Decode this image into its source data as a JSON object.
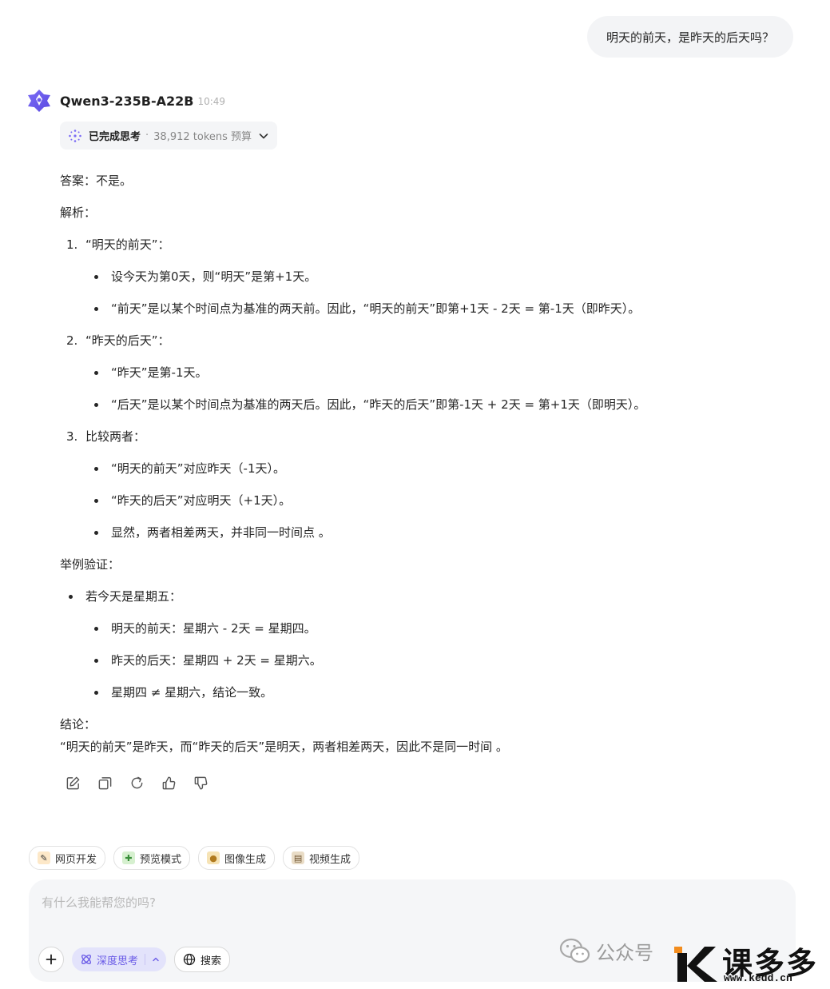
{
  "user_message": "明天的前天，是昨天的后天吗？",
  "assistant": {
    "model_name": "Qwen3-235B-A22B",
    "time": "10:49",
    "think_status": "已完成思考",
    "think_separator": "·",
    "think_budget": "38,912 tokens 预算"
  },
  "answer": {
    "answer_line": "答案：不是。",
    "analysis_label": "解析：",
    "item1_num": "1.",
    "item1_title": "“明天的前天”：",
    "item1_b1": "设今天为第0天，则“明天”是第+1天。",
    "item1_b2": "“前天”是以某个时间点为基准的两天前。因此，“明天的前天”即第+1天 - 2天 = 第-1天（即昨天）。",
    "item2_num": "2.",
    "item2_title": "“昨天的后天”：",
    "item2_b1": "“昨天”是第-1天。",
    "item2_b2": "“后天”是以某个时间点为基准的两天后。因此，“昨天的后天”即第-1天 + 2天 = 第+1天（即明天）。",
    "item3_num": "3.",
    "item3_title": "比较两者：",
    "item3_b1": "“明天的前天”对应昨天（-1天）。",
    "item3_b2": "“昨天的后天”对应明天（+1天）。",
    "item3_b3": "显然，两者相差两天，并非同一时间点 。",
    "example_label": "举例验证：",
    "example_b": "若今天是星期五：",
    "example_b1": "明天的前天：星期六 - 2天 = 星期四。",
    "example_b2": "昨天的后天：星期四 + 2天 = 星期六。",
    "example_b3": "星期四 ≠ 星期六，结论一致。",
    "conclusion_label": "结论：",
    "conclusion_text": "“明天的前天”是昨天，而“昨天的后天”是明天，两者相差两天，因此不是同一时间 。"
  },
  "chips": [
    "网页开发",
    "预览模式",
    "图像生成",
    "视频生成"
  ],
  "input": {
    "placeholder": "有什么我能帮您的吗?",
    "deep_think_label": "深度思考",
    "search_label": "搜索"
  },
  "watermark": {
    "official_account": "公众号",
    "brand_name": "课多多",
    "brand_url": "www.kedd.cn"
  },
  "colors": {
    "accent_purple": "#6b5ce7",
    "bubble_bg": "#f3f4f6",
    "input_bg": "#f5f6f8"
  }
}
